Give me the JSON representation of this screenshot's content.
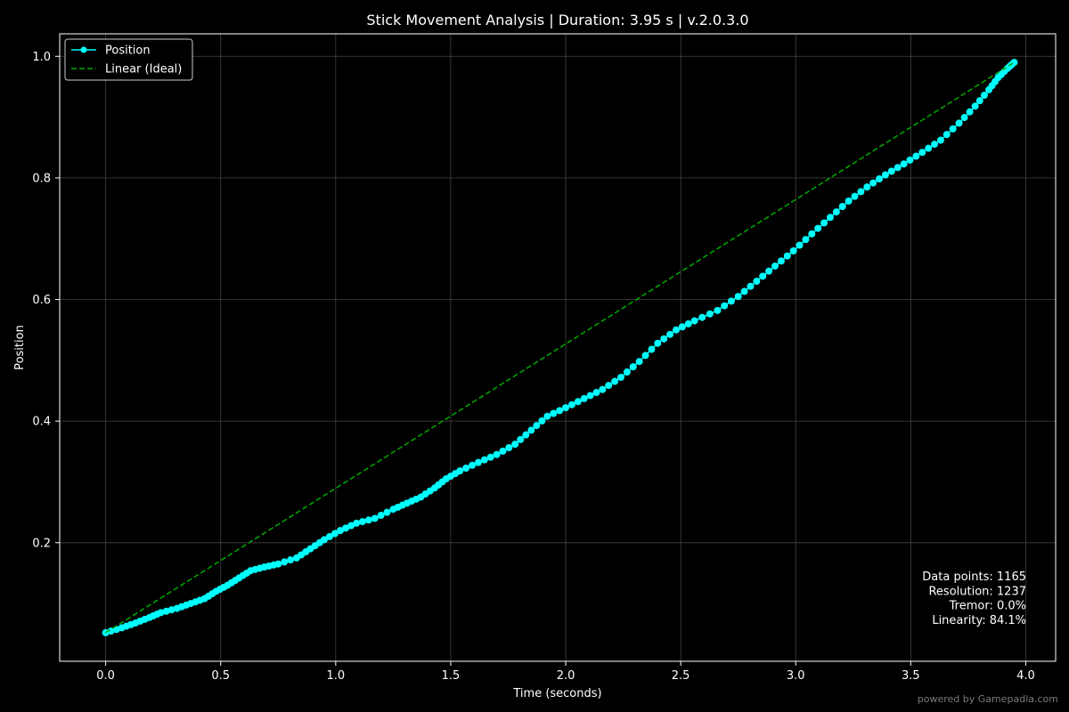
{
  "chart_data": {
    "type": "line",
    "title": "Stick Movement Analysis | Duration: 3.95 s | v.2.0.3.0",
    "xlabel": "Time (seconds)",
    "ylabel": "Position",
    "xlim": [
      -0.2,
      4.13
    ],
    "ylim": [
      0.005,
      1.037
    ],
    "xticks": [
      0.0,
      0.5,
      1.0,
      1.5,
      2.0,
      2.5,
      3.0,
      3.5,
      4.0
    ],
    "xtick_labels": [
      "0.0",
      "0.5",
      "1.0",
      "1.5",
      "2.0",
      "2.5",
      "3.0",
      "3.5",
      "4.0"
    ],
    "yticks": [
      0.2,
      0.4,
      0.6,
      0.8,
      1.0
    ],
    "ytick_labels": [
      "0.2",
      "0.4",
      "0.6",
      "0.8",
      "1.0"
    ],
    "grid": true,
    "legend_position": "top-left",
    "series": [
      {
        "name": "Position",
        "color": "#00ffff",
        "style": "solid-with-markers",
        "x": [
          0.0,
          0.07,
          0.13,
          0.19,
          0.24,
          0.31,
          0.37,
          0.43,
          0.48,
          0.53,
          0.58,
          0.63,
          0.69,
          0.75,
          0.83,
          0.89,
          0.95,
          1.02,
          1.09,
          1.17,
          1.25,
          1.31,
          1.37,
          1.43,
          1.48,
          1.54,
          1.62,
          1.7,
          1.78,
          1.85,
          1.92,
          2.0,
          2.08,
          2.16,
          2.24,
          2.32,
          2.4,
          2.48,
          2.56,
          2.66,
          2.75,
          2.83,
          2.91,
          2.99,
          3.07,
          3.15,
          3.23,
          3.31,
          3.39,
          3.47,
          3.55,
          3.63,
          3.71,
          3.78,
          3.84,
          3.88,
          3.92,
          3.95
        ],
        "y": [
          0.052,
          0.06,
          0.068,
          0.077,
          0.085,
          0.092,
          0.1,
          0.108,
          0.12,
          0.13,
          0.142,
          0.154,
          0.16,
          0.165,
          0.175,
          0.19,
          0.205,
          0.22,
          0.232,
          0.24,
          0.255,
          0.265,
          0.275,
          0.29,
          0.305,
          0.318,
          0.332,
          0.345,
          0.362,
          0.385,
          0.408,
          0.422,
          0.437,
          0.452,
          0.472,
          0.498,
          0.528,
          0.55,
          0.565,
          0.582,
          0.605,
          0.63,
          0.655,
          0.68,
          0.708,
          0.735,
          0.762,
          0.785,
          0.805,
          0.823,
          0.842,
          0.862,
          0.89,
          0.918,
          0.945,
          0.965,
          0.98,
          0.99
        ]
      },
      {
        "name": "Linear (Ideal)",
        "color": "#00aa00",
        "style": "dashed",
        "x": [
          0.0,
          3.95
        ],
        "y": [
          0.052,
          0.99
        ]
      }
    ],
    "annotations": [
      "Data points: 1165",
      "Resolution: 1237",
      "Tremor: 0.0%",
      "Linearity: 84.1%"
    ]
  },
  "watermark": "powered by Gamepadla.com",
  "colors": {
    "background": "#000000",
    "axes_edge": "#ffffff",
    "text": "#ffffff",
    "grid": "#444444"
  }
}
